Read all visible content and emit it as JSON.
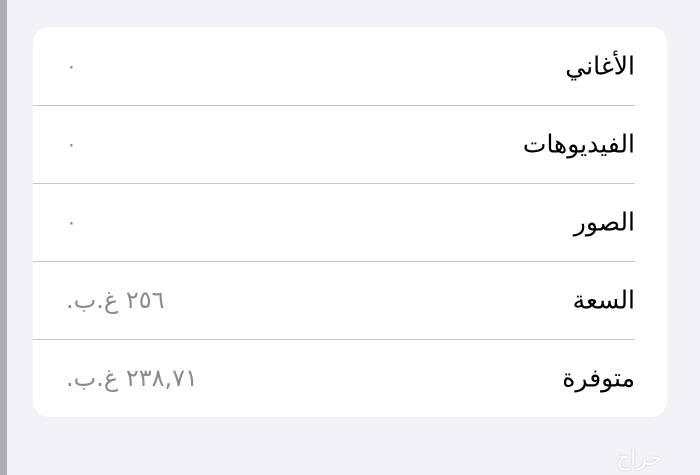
{
  "storage_info": {
    "rows": [
      {
        "label": "الأغاني",
        "value": "٠"
      },
      {
        "label": "الفيديوهات",
        "value": "٠"
      },
      {
        "label": "الصور",
        "value": "٠"
      },
      {
        "label": "السعة",
        "value": "٢٥٦ غ.ب."
      },
      {
        "label": "متوفرة",
        "value": "٢٣٨,٧١ غ.ب."
      }
    ]
  },
  "watermark": "حراج"
}
